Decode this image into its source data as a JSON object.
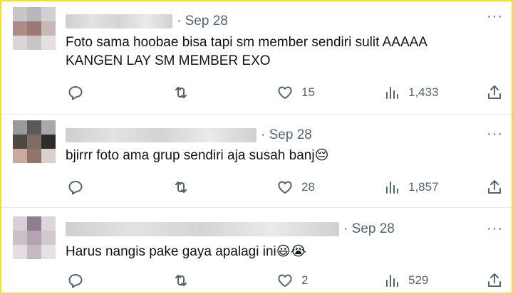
{
  "tweets": [
    {
      "date": "· Sep 28",
      "text_line1": "Foto sama hoobae bisa tapi sm member sendiri sulit AAAAA",
      "text_line2": "KANGEN LAY SM MEMBER EXO",
      "text_emoji": "",
      "replies": "",
      "retweets": "",
      "likes": "15",
      "views": "1,433"
    },
    {
      "date": "· Sep 28",
      "text_line1": "bjirrr foto ama grup sendiri aja susah banj",
      "text_line2": "",
      "text_emoji": "😔",
      "replies": "",
      "retweets": "",
      "likes": "28",
      "views": "1,857"
    },
    {
      "date": "· Sep 28",
      "text_line1": "Harus nangis pake gaya apalagi ini",
      "text_line2": "",
      "text_emoji": "😃😭",
      "replies": "",
      "retweets": "",
      "likes": "2",
      "views": "529"
    }
  ],
  "icons": {
    "more": "more-horizontal-icon",
    "reply": "reply-icon",
    "retweet": "retweet-icon",
    "like": "heart-icon",
    "views": "views-chart-icon",
    "share": "share-icon"
  },
  "colors": {
    "border_highlight": "#f3e21b",
    "meta_text": "#536471",
    "body_text": "#0f1419",
    "divider": "#e6ecf0"
  }
}
